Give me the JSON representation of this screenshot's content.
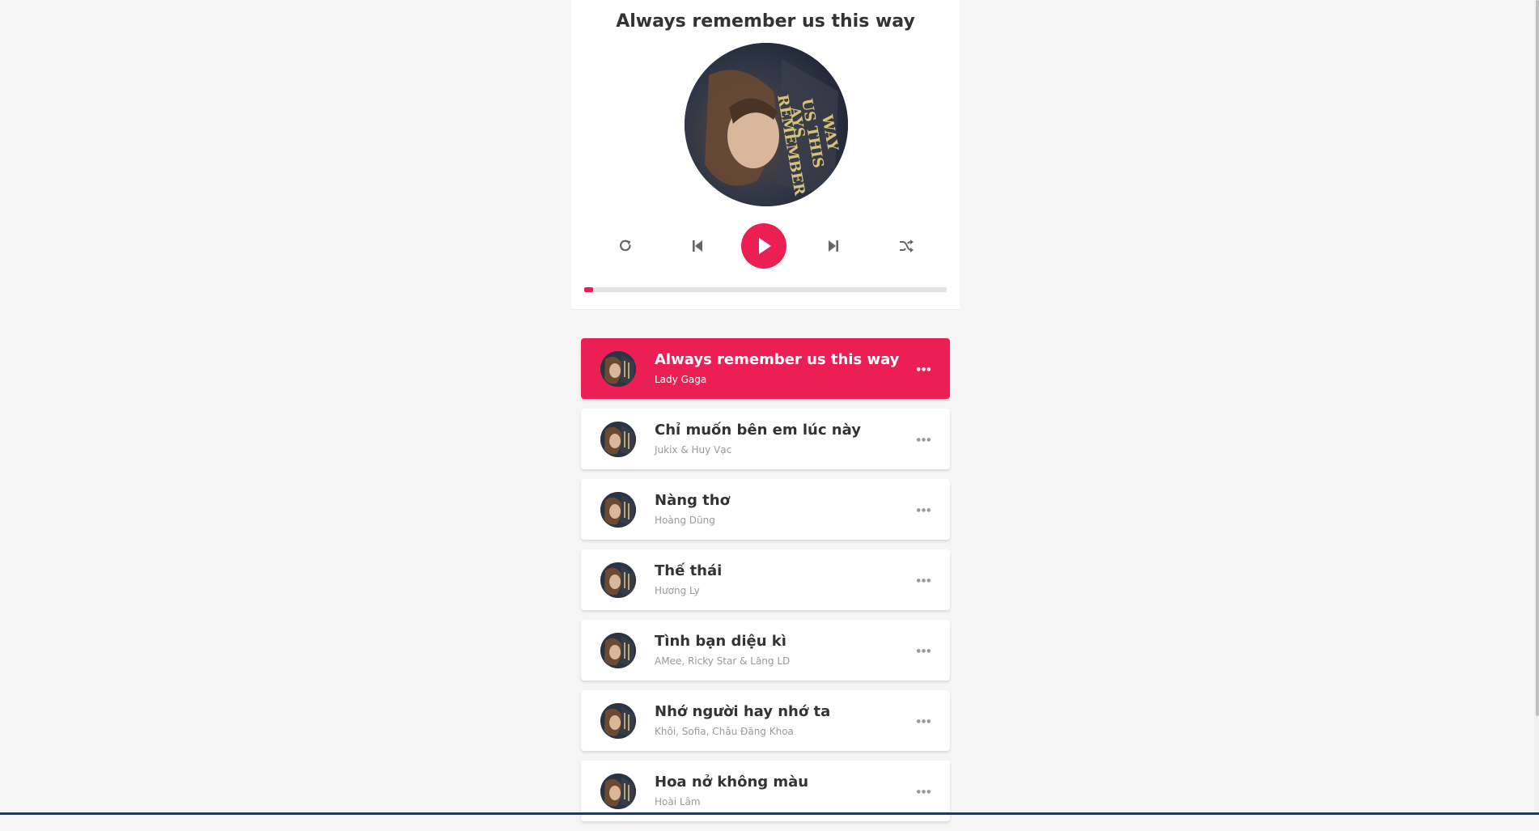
{
  "dashboard": {
    "current_song_title": "Always remember us this way",
    "cd_image": "album-cover",
    "controls": {
      "repeat_icon": "repeat-icon",
      "prev_icon": "skip-back-icon",
      "play_icon": "play-icon",
      "next_icon": "skip-forward-icon",
      "random_icon": "shuffle-icon"
    },
    "progress": 0.025
  },
  "playlist": [
    {
      "title": "Always remember us this way",
      "author": "Lady Gaga",
      "active": true
    },
    {
      "title": "Chỉ muốn bên em lúc này",
      "author": "Jukix & Huy Vạc",
      "active": false
    },
    {
      "title": "Nàng thơ",
      "author": "Hoàng Dũng",
      "active": false
    },
    {
      "title": "Thế thái",
      "author": "Hương Ly",
      "active": false
    },
    {
      "title": "Tình bạn diệu kì",
      "author": "AMee, Ricky Star & Lăng LD",
      "active": false
    },
    {
      "title": "Nhớ người hay nhớ ta",
      "author": "Khôi, Sofia, Châu Đăng Khoa",
      "active": false
    },
    {
      "title": "Hoa nở không màu",
      "author": "Hoài Lâm",
      "active": false
    }
  ],
  "colors": {
    "primary": "#ec1f55",
    "background": "#f5f5f5"
  }
}
